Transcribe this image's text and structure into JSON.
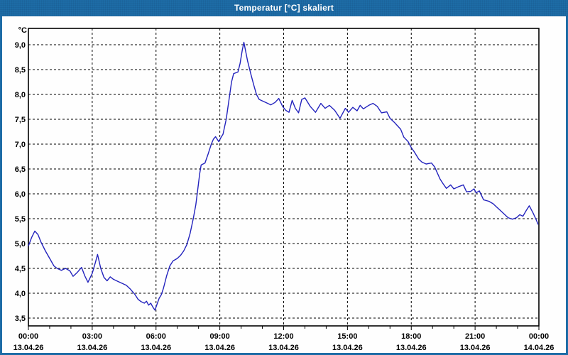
{
  "window": {
    "title": "Temperatur [°C] skaliert",
    "titlebar_color": "#1d6ca6",
    "border_color": "#1d6ca6"
  },
  "chart_data": {
    "type": "line",
    "title": "Temperatur [°C] skaliert",
    "unit_label": "°C",
    "line_color": "#2323bd",
    "grid": "dashed-black",
    "background": "#fefefe",
    "x_axis": {
      "range_hours": [
        0,
        24
      ],
      "major_tick_every_hours": 3,
      "minor_tick_every_hours": 1,
      "ticks": [
        {
          "h": 0,
          "time": "00:00",
          "date": "13.04.26"
        },
        {
          "h": 3,
          "time": "03:00",
          "date": "13.04.26"
        },
        {
          "h": 6,
          "time": "06:00",
          "date": "13.04.26"
        },
        {
          "h": 9,
          "time": "09:00",
          "date": "13.04.26"
        },
        {
          "h": 12,
          "time": "12:00",
          "date": "13.04.26"
        },
        {
          "h": 15,
          "time": "15:00",
          "date": "13.04.26"
        },
        {
          "h": 18,
          "time": "18:00",
          "date": "13.04.26"
        },
        {
          "h": 21,
          "time": "21:00",
          "date": "13.04.26"
        },
        {
          "h": 24,
          "time": "00:00",
          "date": "14.04.26"
        }
      ]
    },
    "y_axis": {
      "min_gridline": 3.5,
      "max_gridline": 9.0,
      "step": 0.5,
      "ticks": [
        {
          "v": 9.0,
          "label": "9,0"
        },
        {
          "v": 8.5,
          "label": "8,5"
        },
        {
          "v": 8.0,
          "label": "8,0"
        },
        {
          "v": 7.5,
          "label": "7,5"
        },
        {
          "v": 7.0,
          "label": "7,0"
        },
        {
          "v": 6.5,
          "label": "6,5"
        },
        {
          "v": 6.0,
          "label": "6,0"
        },
        {
          "v": 5.5,
          "label": "5,5"
        },
        {
          "v": 5.0,
          "label": "5,0"
        },
        {
          "v": 4.5,
          "label": "4,5"
        },
        {
          "v": 4.0,
          "label": "4,0"
        },
        {
          "v": 3.5,
          "label": "3,5"
        }
      ]
    },
    "series": [
      {
        "name": "Temperatur",
        "points": [
          [
            0.0,
            4.95
          ],
          [
            0.15,
            5.12
          ],
          [
            0.3,
            5.25
          ],
          [
            0.45,
            5.18
          ],
          [
            0.6,
            5.02
          ],
          [
            0.8,
            4.85
          ],
          [
            1.0,
            4.7
          ],
          [
            1.2,
            4.55
          ],
          [
            1.35,
            4.5
          ],
          [
            1.55,
            4.46
          ],
          [
            1.75,
            4.5
          ],
          [
            1.95,
            4.45
          ],
          [
            2.1,
            4.34
          ],
          [
            2.3,
            4.42
          ],
          [
            2.5,
            4.52
          ],
          [
            2.65,
            4.35
          ],
          [
            2.8,
            4.22
          ],
          [
            3.0,
            4.4
          ],
          [
            3.15,
            4.62
          ],
          [
            3.25,
            4.78
          ],
          [
            3.4,
            4.5
          ],
          [
            3.55,
            4.32
          ],
          [
            3.7,
            4.25
          ],
          [
            3.85,
            4.33
          ],
          [
            4.0,
            4.28
          ],
          [
            4.2,
            4.24
          ],
          [
            4.4,
            4.2
          ],
          [
            4.6,
            4.16
          ],
          [
            4.8,
            4.08
          ],
          [
            5.0,
            3.98
          ],
          [
            5.15,
            3.88
          ],
          [
            5.3,
            3.83
          ],
          [
            5.45,
            3.8
          ],
          [
            5.55,
            3.84
          ],
          [
            5.65,
            3.76
          ],
          [
            5.75,
            3.8
          ],
          [
            5.85,
            3.72
          ],
          [
            5.95,
            3.66
          ],
          [
            6.05,
            3.78
          ],
          [
            6.15,
            3.9
          ],
          [
            6.25,
            3.97
          ],
          [
            6.35,
            4.1
          ],
          [
            6.5,
            4.35
          ],
          [
            6.65,
            4.55
          ],
          [
            6.8,
            4.65
          ],
          [
            7.0,
            4.7
          ],
          [
            7.15,
            4.76
          ],
          [
            7.3,
            4.85
          ],
          [
            7.45,
            4.98
          ],
          [
            7.6,
            5.2
          ],
          [
            7.75,
            5.5
          ],
          [
            7.87,
            5.78
          ],
          [
            7.95,
            6.05
          ],
          [
            8.05,
            6.4
          ],
          [
            8.12,
            6.58
          ],
          [
            8.3,
            6.62
          ],
          [
            8.45,
            6.8
          ],
          [
            8.6,
            7.0
          ],
          [
            8.7,
            7.1
          ],
          [
            8.8,
            7.15
          ],
          [
            8.95,
            7.05
          ],
          [
            9.05,
            7.13
          ],
          [
            9.15,
            7.2
          ],
          [
            9.3,
            7.5
          ],
          [
            9.45,
            7.95
          ],
          [
            9.55,
            8.25
          ],
          [
            9.65,
            8.42
          ],
          [
            9.85,
            8.45
          ],
          [
            9.95,
            8.62
          ],
          [
            10.05,
            8.88
          ],
          [
            10.13,
            9.05
          ],
          [
            10.3,
            8.68
          ],
          [
            10.45,
            8.42
          ],
          [
            10.6,
            8.18
          ],
          [
            10.72,
            8.0
          ],
          [
            10.85,
            7.9
          ],
          [
            11.0,
            7.87
          ],
          [
            11.2,
            7.83
          ],
          [
            11.4,
            7.79
          ],
          [
            11.6,
            7.84
          ],
          [
            11.77,
            7.92
          ],
          [
            11.95,
            7.76
          ],
          [
            12.1,
            7.68
          ],
          [
            12.25,
            7.64
          ],
          [
            12.4,
            7.88
          ],
          [
            12.55,
            7.72
          ],
          [
            12.7,
            7.63
          ],
          [
            12.85,
            7.9
          ],
          [
            13.0,
            7.93
          ],
          [
            13.25,
            7.76
          ],
          [
            13.5,
            7.64
          ],
          [
            13.75,
            7.82
          ],
          [
            13.95,
            7.72
          ],
          [
            14.15,
            7.78
          ],
          [
            14.4,
            7.68
          ],
          [
            14.65,
            7.52
          ],
          [
            14.9,
            7.72
          ],
          [
            15.05,
            7.64
          ],
          [
            15.25,
            7.74
          ],
          [
            15.45,
            7.67
          ],
          [
            15.6,
            7.78
          ],
          [
            15.75,
            7.71
          ],
          [
            16.0,
            7.78
          ],
          [
            16.2,
            7.82
          ],
          [
            16.4,
            7.76
          ],
          [
            16.6,
            7.63
          ],
          [
            16.85,
            7.65
          ],
          [
            17.0,
            7.52
          ],
          [
            17.2,
            7.44
          ],
          [
            17.35,
            7.37
          ],
          [
            17.5,
            7.3
          ],
          [
            17.65,
            7.14
          ],
          [
            17.85,
            7.05
          ],
          [
            18.0,
            6.93
          ],
          [
            18.15,
            6.84
          ],
          [
            18.35,
            6.7
          ],
          [
            18.5,
            6.64
          ],
          [
            18.7,
            6.6
          ],
          [
            18.95,
            6.62
          ],
          [
            19.1,
            6.54
          ],
          [
            19.35,
            6.3
          ],
          [
            19.5,
            6.2
          ],
          [
            19.65,
            6.11
          ],
          [
            19.85,
            6.18
          ],
          [
            20.0,
            6.1
          ],
          [
            20.2,
            6.14
          ],
          [
            20.45,
            6.18
          ],
          [
            20.6,
            6.04
          ],
          [
            20.8,
            6.05
          ],
          [
            20.95,
            6.1
          ],
          [
            21.05,
            6.02
          ],
          [
            21.2,
            6.06
          ],
          [
            21.4,
            5.88
          ],
          [
            21.65,
            5.85
          ],
          [
            21.85,
            5.8
          ],
          [
            22.0,
            5.74
          ],
          [
            22.2,
            5.66
          ],
          [
            22.35,
            5.6
          ],
          [
            22.55,
            5.52
          ],
          [
            22.75,
            5.49
          ],
          [
            22.95,
            5.52
          ],
          [
            23.1,
            5.58
          ],
          [
            23.25,
            5.55
          ],
          [
            23.4,
            5.66
          ],
          [
            23.55,
            5.76
          ],
          [
            23.72,
            5.62
          ],
          [
            23.85,
            5.5
          ],
          [
            23.97,
            5.38
          ]
        ]
      }
    ]
  }
}
